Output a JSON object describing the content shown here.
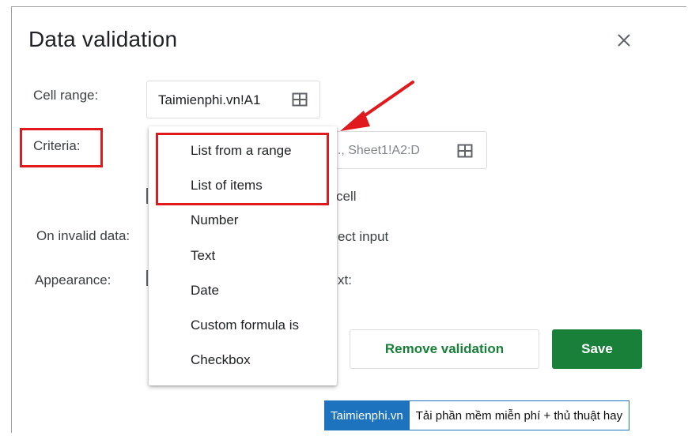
{
  "dialog": {
    "title": "Data validation"
  },
  "labels": {
    "cell_range": "Cell range:",
    "criteria": "Criteria:",
    "on_invalid": "On invalid data:",
    "appearance": "Appearance:"
  },
  "cell_range": {
    "value": "Taimienphi.vn!A1"
  },
  "criteria_range": {
    "placeholder_visible": "g., Sheet1!A2:D"
  },
  "partials": {
    "cell": "cell",
    "ect_input": "ect input",
    "xt": "xt:"
  },
  "dropdown": {
    "items": [
      "List from a range",
      "List of items",
      "Number",
      "Text",
      "Date",
      "Custom formula is",
      "Checkbox"
    ]
  },
  "buttons": {
    "remove": "Remove validation",
    "save": "Save"
  },
  "watermark": {
    "brand": "Taimienphi.vn",
    "tagline": "Tải phần mềm miễn phí + thủ thuật hay"
  },
  "colors": {
    "accent_green": "#188038",
    "highlight_red": "#e0191c",
    "brand_blue": "#1e73be"
  },
  "icons": {
    "close": "close-icon",
    "range_picker": "grid-icon",
    "annotation_arrow": "red-arrow"
  }
}
